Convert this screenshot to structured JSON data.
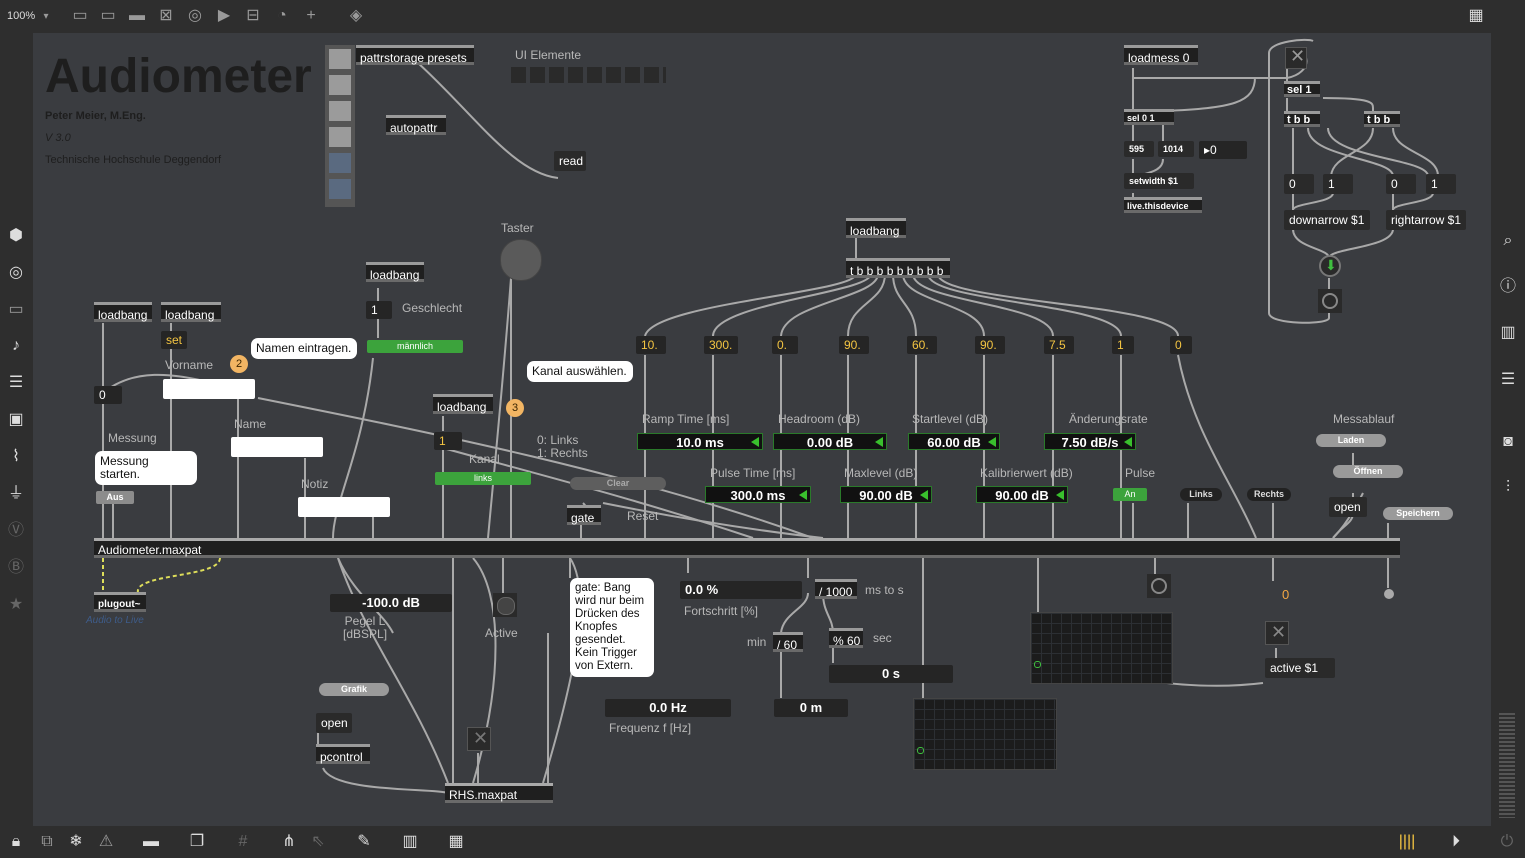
{
  "toolbar": {
    "zoom": "100%",
    "icons": [
      "presentation-icon",
      "comment-icon",
      "message-icon",
      "toggle-icon",
      "button-icon",
      "number-icon",
      "slider-icon",
      "dial-icon",
      "add-icon",
      "paint-bucket-icon"
    ],
    "grid_icon": "grid-icon"
  },
  "patch": {
    "title": "Audiometer",
    "author": "Peter Meier, M.Eng.",
    "version": "V 3.0",
    "institution": "Technische Hochschule Deggendorf"
  },
  "objects": {
    "pattrstorage": "pattrstorage presets",
    "autopattr": "autopattr",
    "read": "read",
    "ui_elemente": "UI Elemente",
    "loadmess": "loadmess 0",
    "sel01": "sel 0 1",
    "n595": "595",
    "n1014": "1014",
    "num0": "0",
    "setwidth": "setwidth $1",
    "livethisdevice": "live.thisdevice",
    "sel1": "sel 1",
    "tbb1": "t b b",
    "tbb2": "t b b",
    "downarrow": "downarrow $1",
    "rightarrow": "rightarrow $1",
    "loadbang_top": "loadbang",
    "tbbb": "t b b b b b b b b b",
    "taster": "Taster",
    "loadbang_g": "loadbang",
    "geschlecht": "Geschlecht",
    "maennlich": "männlich",
    "loadbang_1": "loadbang",
    "loadbang_2": "loadbang",
    "set": "set",
    "vorname": "Vorname",
    "name": "Name",
    "notiz": "Notiz",
    "messung": "Messung",
    "aus": "Aus",
    "loadbang_k": "loadbang",
    "kanal": "Kanal",
    "links_btn": "links",
    "kanal_info": "0: Links\n1: Rechts",
    "clear": "Clear",
    "gate": "gate",
    "reset": "Reset",
    "audiometer_maxpat": "Audiometer.maxpat",
    "plugout": "plugout~",
    "audio_to_live": "Audio to Live",
    "pegel_value": "-100.0 dB",
    "pegel_label": "Pegel L\n[dBSPL]",
    "active": "Active",
    "grafik": "Grafik",
    "open1": "open",
    "pcontrol": "pcontrol",
    "rhs_maxpat": "RHS.maxpat",
    "gate_comment": "gate: Bang\nwird nur beim\nDrücken des\nKnopfes\ngesendet.\nKein Trigger\nvon Extern.",
    "frequenz_value": "0.0 Hz",
    "frequenz_label": "Frequenz f [Hz]",
    "fortschritt_value": "0.0 %",
    "fortschritt_label": "Fortschritt [%]",
    "div1000": "/ 1000",
    "ms_to_s": "ms to s",
    "min": "min",
    "div60": "/ 60",
    "mod60": "% 60",
    "sec": "sec",
    "zero_s": "0 s",
    "zero_m": "0 m",
    "messablauf": "Messablauf",
    "laden": "Laden",
    "oeffnen": "Öffnen",
    "open2": "open",
    "speichern": "Speichern",
    "pulse": "Pulse",
    "an": "An",
    "links": "Links",
    "rechts": "Rechts",
    "orange_zero": "0",
    "active_msg": "active $1"
  },
  "bubbles": {
    "namen": "Namen eintragen.",
    "kanal": "Kanal auswählen.",
    "messung": "Messung starten.",
    "badge2": "2",
    "badge3": "3"
  },
  "presets": [
    "10.",
    "300.",
    "0.",
    "90.",
    "60.",
    "90.",
    "7.5",
    "1",
    "0"
  ],
  "params": {
    "ramp_label": "Ramp Time [ms]",
    "ramp_value": "10.0 ms",
    "pulse_label": "Pulse Time [ms]",
    "pulse_value": "300.0 ms",
    "headroom_label": "Headroom (dB)",
    "headroom_value": "0.00 dB",
    "maxlevel_label": "Maxlevel (dB)",
    "maxlevel_value": "90.00 dB",
    "startlevel_label": "Startlevel (dB)",
    "startlevel_value": "60.00 dB",
    "kalib_label": "Kalibrierwert (dB)",
    "kalib_value": "90.00 dB",
    "aenderung_label": "Änderungsrate",
    "aenderung_value": "7.50 dB/s"
  },
  "sidebar_left": [
    "cube-icon",
    "target-icon",
    "monitor-icon",
    "note-icon",
    "media-list-icon",
    "image-icon",
    "clip-icon",
    "plug-icon",
    "v-icon",
    "b-icon",
    "star-icon"
  ],
  "sidebar_right": [
    "search-icon",
    "info-icon",
    "columns-icon",
    "list-icon",
    "camera-icon",
    "sliders-icon"
  ],
  "toolbar_bottom": [
    "lock-icon",
    "edit-icon",
    "snowflake-icon",
    "warning-icon",
    "comment-icon",
    "windows-icon",
    "grid-icon",
    "hierarchy-icon",
    "cursor-icon",
    "wrench-icon",
    "piano-icon",
    "keyboard-icon"
  ]
}
